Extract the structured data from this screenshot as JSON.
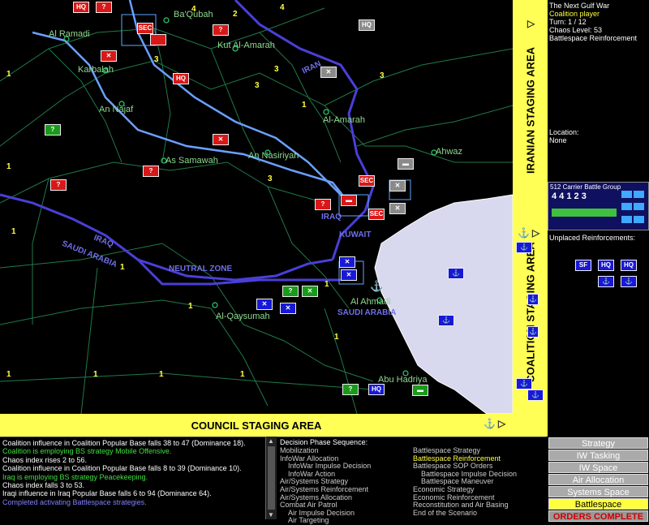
{
  "map": {
    "cities": [
      {
        "name": "Al Ramadi"
      },
      {
        "name": "Ba'Qubah"
      },
      {
        "name": "Karbalah"
      },
      {
        "name": "Kut Al-Amarah"
      },
      {
        "name": "An Najaf"
      },
      {
        "name": "Al-Amarah"
      },
      {
        "name": "As Samawah"
      },
      {
        "name": "An Nasiriyah"
      },
      {
        "name": "Ahwaz"
      },
      {
        "name": "Al Ahmadi"
      },
      {
        "name": "Al-Qaysumah"
      },
      {
        "name": "Abu Hadriya"
      }
    ],
    "regions": {
      "iran": "IRAN",
      "iraq1": "IRAQ",
      "iraq2": "IRAQ",
      "kuwait": "KUWAIT",
      "neutral": "NEUTRAL ZONE",
      "saudi1": "SAUDI ARABIA",
      "saudi2": "SAUDI ARABIA"
    },
    "unit_labels": {
      "sec": "SEC",
      "hq": "HQ",
      "q": "?",
      "sf": "SF"
    }
  },
  "staging": {
    "iranian": "IRANIAN STAGING AREA",
    "coalition": "COALITION STAGING AREA",
    "council": "COUNCIL STAGING AREA"
  },
  "info": {
    "game": "The Next Gulf War",
    "player": "Coalition player",
    "turn": "Turn: 1 / 12",
    "chaos": "Chaos Level: 53",
    "phase": "Battlespace Reinforcement",
    "location_label": "Location:",
    "location_value": "None"
  },
  "carrier": {
    "title": "512 Carrier Battle Group",
    "numbers": "4 4 1 2 3"
  },
  "unplaced": {
    "title": "Unplaced Reinforcements:",
    "sf": "SF",
    "hq": "HQ"
  },
  "log": [
    {
      "text": "Coalition influence in Coalition Popular Base falls 38 to 47 (Dominance 18).",
      "color": "w"
    },
    {
      "text": "Coalition is employing BS strategy Mobile Offensive.",
      "color": "g"
    },
    {
      "text": "Chaos index rises 2 to 56.",
      "color": "w"
    },
    {
      "text": "Coalition influence in Coalition Popular Base falls 8 to 39 (Dominance 10).",
      "color": "w"
    },
    {
      "text": "Iraq is employing BS strategy Peacekeeping.",
      "color": "g"
    },
    {
      "text": "Chaos index falls 3 to 53.",
      "color": "w"
    },
    {
      "text": "Iraqi influence in Iraq Popular Base falls 6 to 94 (Dominance 64).",
      "color": "w"
    },
    {
      "text": "Completed activating Battlespace strategies.",
      "color": "b"
    }
  ],
  "phase_seq": {
    "title": "Decision Phase Sequence:",
    "col1": [
      {
        "t": "Mobilization",
        "i": false
      },
      {
        "t": "InfoWar Allocation",
        "i": false
      },
      {
        "t": "InfoWar Impulse Decision",
        "i": true
      },
      {
        "t": "InfoWar Action",
        "i": true
      },
      {
        "t": "Air/Systems Strategy",
        "i": false
      },
      {
        "t": "Air/Systems Reinforcement",
        "i": false
      },
      {
        "t": "Air/Systems Allocation",
        "i": false
      },
      {
        "t": "Combat Air Patrol",
        "i": false
      },
      {
        "t": "Air Impulse Decision",
        "i": true
      },
      {
        "t": "Air Targeting",
        "i": true
      }
    ],
    "col2": [
      {
        "t": "Battlespace Strategy",
        "i": false,
        "a": false
      },
      {
        "t": "Battlespace Reinforcement",
        "i": false,
        "a": true
      },
      {
        "t": "Battlespace SOP Orders",
        "i": false,
        "a": false
      },
      {
        "t": "Battlespace Impulse Decision",
        "i": true,
        "a": false
      },
      {
        "t": "Battlespace Maneuver",
        "i": true,
        "a": false
      },
      {
        "t": "Economic Strategy",
        "i": false,
        "a": false
      },
      {
        "t": "Economic Reinforcement",
        "i": false,
        "a": false
      },
      {
        "t": "Reconstitution and Air Basing",
        "i": false,
        "a": false
      },
      {
        "t": "End of the Scenario",
        "i": false,
        "a": false
      }
    ]
  },
  "menu": {
    "strategy": "Strategy",
    "iw_tasking": "IW Tasking",
    "iw_space": "IW Space",
    "air_allocation": "Air Allocation",
    "systems_space": "Systems Space",
    "battlespace": "Battlespace",
    "orders_complete": "ORDERS COMPLETE"
  },
  "numbers": {
    "n1": "1",
    "n2": "2",
    "n3": "3",
    "n4": "4"
  },
  "colors": {
    "accent": "#ffff55",
    "red": "#d81818",
    "blue": "#1818d8",
    "green": "#1a9a1a",
    "border": "#3f3fd8"
  }
}
